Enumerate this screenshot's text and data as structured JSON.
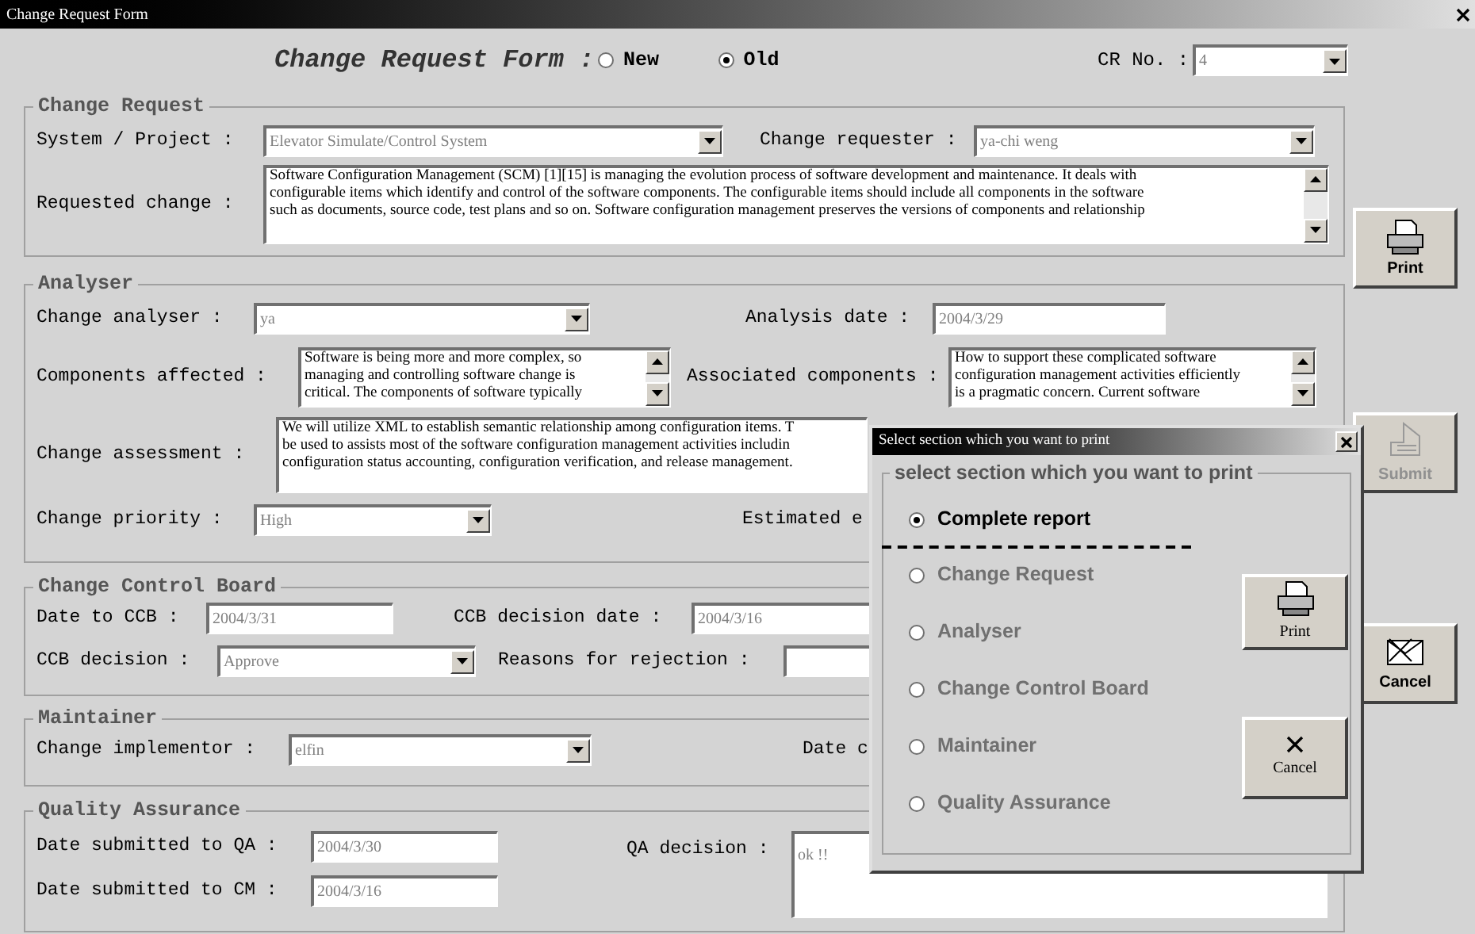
{
  "window": {
    "title": "Change Request Form"
  },
  "header": {
    "title": "Change Request Form :",
    "modes": [
      {
        "label": "New",
        "selected": false
      },
      {
        "label": "Old",
        "selected": true
      }
    ],
    "cr_label": "CR No. :",
    "cr_value": "4"
  },
  "change_request": {
    "title": "Change Request",
    "system_label": "System / Project :",
    "system_value": "Elevator Simulate/Control System",
    "requester_label": "Change requester :",
    "requester_value": "ya-chi weng",
    "requested_label": "Requested change :",
    "requested_lines": [
      "Software Configuration Management (SCM) [1][15] is managing the evolution process of software development and maintenance. It deals with",
      "configurable items which identify and control of the software components. The configurable items should include all components in the software",
      "such as documents, source code, test plans and so on. Software configuration management preserves the versions of components and relationship"
    ]
  },
  "analyser": {
    "title": "Analyser",
    "analyser_label": "Change analyser :",
    "analyser_value": "ya",
    "date_label": "Analysis date :",
    "date_value": "2004/3/29",
    "affected_label": "Components affected :",
    "affected_lines": [
      "Software is being more and more complex, so",
      "managing and controlling software change is",
      "critical. The components of software typically"
    ],
    "associated_label": "Associated components :",
    "associated_lines": [
      "How to support these complicated software",
      "configuration management activities efficiently",
      "is a pragmatic concern. Current software"
    ],
    "assessment_label": "Change assessment :",
    "assessment_lines": [
      "We will utilize XML to establish semantic relationship among configuration items. T",
      "be used to assists most of the software configuration management activities includin",
      "configuration status accounting, configuration verification, and release management."
    ],
    "priority_label": "Change priority :",
    "priority_value": "High",
    "effort_label": "Estimated e"
  },
  "ccb": {
    "title": "Change Control Board",
    "date_label": "Date to CCB :",
    "date_value": "2004/3/31",
    "decision_date_label": "CCB decision date :",
    "decision_date_value": "2004/3/16",
    "decision_label": "CCB decision :",
    "decision_value": "Approve",
    "reasons_label": "Reasons for rejection :"
  },
  "maintainer": {
    "title": "Maintainer",
    "implementor_label": "Change implementor :",
    "implementor_value": "elfin",
    "date_label": "Date c"
  },
  "qa": {
    "title": "Quality Assurance",
    "qa_date_label": "Date submitted to QA :",
    "qa_date_value": "2004/3/30",
    "cm_date_label": "Date submitted to CM :",
    "cm_date_value": "2004/3/16",
    "decision_label": "QA decision :",
    "decision_value": "ok !!"
  },
  "side_buttons": [
    {
      "kind": "print",
      "label": "Print",
      "disabled": false
    },
    {
      "kind": "submit",
      "label": "Submit",
      "disabled": true
    },
    {
      "kind": "cancel",
      "label": "Cancel",
      "disabled": false
    }
  ],
  "print_dialog": {
    "title": "Select section which you want to print",
    "group_title": "select section which you want to print",
    "options": [
      {
        "label": "Complete report",
        "selected": true,
        "disabled": false
      },
      {
        "label": "Change Request",
        "selected": false,
        "disabled": true
      },
      {
        "label": "Analyser",
        "selected": false,
        "disabled": true
      },
      {
        "label": "Change Control Board",
        "selected": false,
        "disabled": true
      },
      {
        "label": "Maintainer",
        "selected": false,
        "disabled": true
      },
      {
        "label": "Quality Assurance",
        "selected": false,
        "disabled": true
      }
    ],
    "buttons": [
      {
        "kind": "print",
        "label": "Print"
      },
      {
        "kind": "cancel",
        "label": "Cancel"
      }
    ]
  }
}
